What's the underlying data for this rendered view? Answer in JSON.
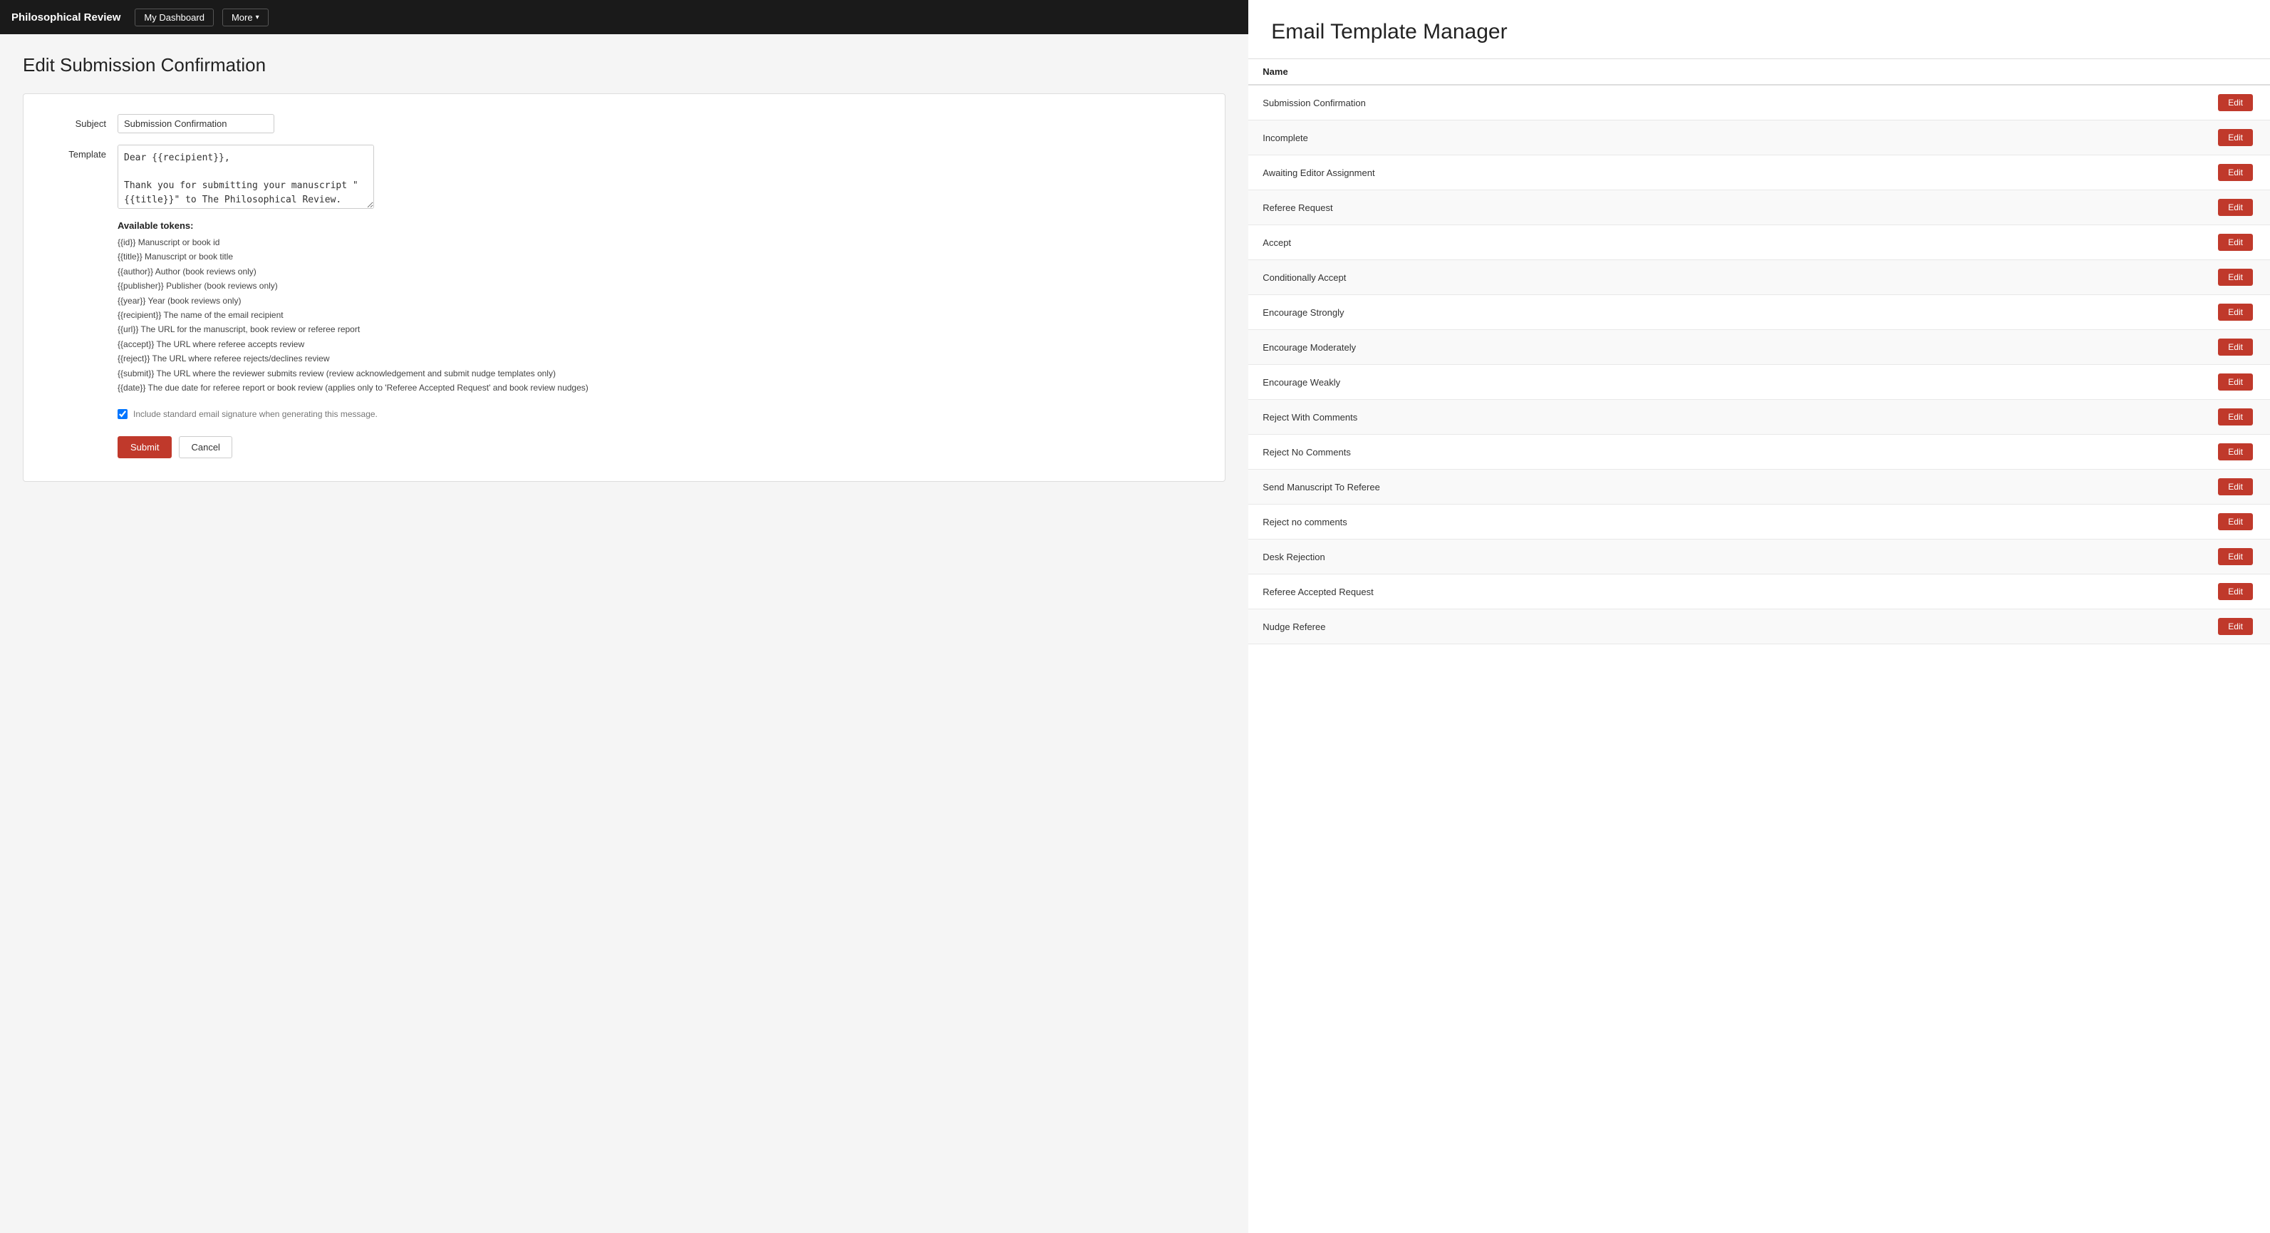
{
  "navbar": {
    "brand": "Philosophical Review",
    "dashboard_label": "My Dashboard",
    "more_label": "More"
  },
  "left": {
    "page_title": "Edit Submission Confirmation",
    "form": {
      "subject_label": "Subject",
      "subject_value": "Submission Confirmation",
      "template_label": "Template",
      "template_value": "Dear {{recipient}},\n\nThank you for submitting your manuscript \"{{title}}\" to The Philosophical Review.",
      "tokens_title": "Available tokens:",
      "tokens": [
        "{{id}} Manuscript or book id",
        "{{title}} Manuscript or book title",
        "{{author}} Author (book reviews only)",
        "{{publisher}} Publisher (book reviews only)",
        "{{year}} Year (book reviews only)",
        "{{recipient}} The name of the email recipient",
        "{{url}} The URL for the manuscript, book review or referee report",
        "{{accept}} The URL where referee accepts review",
        "{{reject}} The URL where referee rejects/declines review",
        "{{submit}} The URL where the reviewer submits review (review acknowledgement and submit nudge templates only)",
        "{{date}} The due date for referee report or book review (applies only to 'Referee Accepted Request' and book review nudges)"
      ],
      "checkbox_label": "Include standard email signature when generating this message.",
      "submit_label": "Submit",
      "cancel_label": "Cancel"
    }
  },
  "right": {
    "title": "Email Template Manager",
    "table": {
      "col_name": "Name",
      "col_action": "",
      "rows": [
        {
          "name": "Submission Confirmation",
          "action": "Edit"
        },
        {
          "name": "Incomplete",
          "action": "Edit"
        },
        {
          "name": "Awaiting Editor Assignment",
          "action": "Edit"
        },
        {
          "name": "Referee Request",
          "action": "Edit"
        },
        {
          "name": "Accept",
          "action": "Edit"
        },
        {
          "name": "Conditionally Accept",
          "action": "Edit"
        },
        {
          "name": "Encourage Strongly",
          "action": "Edit"
        },
        {
          "name": "Encourage Moderately",
          "action": "Edit"
        },
        {
          "name": "Encourage Weakly",
          "action": "Edit"
        },
        {
          "name": "Reject With Comments",
          "action": "Edit"
        },
        {
          "name": "Reject No Comments",
          "action": "Edit"
        },
        {
          "name": "Send Manuscript To Referee",
          "action": "Edit"
        },
        {
          "name": "Reject no comments",
          "action": "Edit"
        },
        {
          "name": "Desk Rejection",
          "action": "Edit"
        },
        {
          "name": "Referee Accepted Request",
          "action": "Edit"
        },
        {
          "name": "Nudge Referee",
          "action": "Edit"
        }
      ]
    }
  }
}
